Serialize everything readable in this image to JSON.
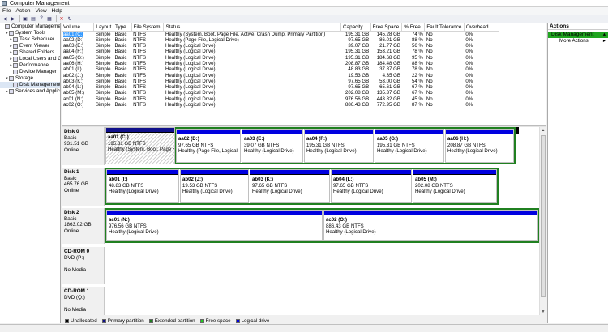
{
  "window": {
    "title": "Computer Management"
  },
  "menu": [
    "File",
    "Action",
    "View",
    "Help"
  ],
  "toolbar": {
    "icons": [
      "back-arrow-icon",
      "forward-arrow-icon",
      "up-folder-icon",
      "properties-icon",
      "help-icon",
      "snap-in-icon",
      "delete-icon",
      "refresh-icon"
    ]
  },
  "tree": [
    {
      "label": "Computer Management",
      "indent": 0,
      "expander": "",
      "selected": false
    },
    {
      "label": "System Tools",
      "indent": 1,
      "expander": "▾",
      "selected": false
    },
    {
      "label": "Task Scheduler",
      "indent": 2,
      "expander": "▸",
      "selected": false
    },
    {
      "label": "Event Viewer",
      "indent": 2,
      "expander": "▸",
      "selected": false
    },
    {
      "label": "Shared Folders",
      "indent": 2,
      "expander": "▸",
      "selected": false
    },
    {
      "label": "Local Users and G",
      "indent": 2,
      "expander": "▸",
      "selected": false
    },
    {
      "label": "Performance",
      "indent": 2,
      "expander": "▸",
      "selected": false
    },
    {
      "label": "Device Manager",
      "indent": 2,
      "expander": "",
      "selected": false
    },
    {
      "label": "Storage",
      "indent": 1,
      "expander": "▾",
      "selected": false
    },
    {
      "label": "Disk Management",
      "indent": 2,
      "expander": "",
      "selected": true
    },
    {
      "label": "Services and Applic",
      "indent": 1,
      "expander": "▸",
      "selected": false
    }
  ],
  "volume_table": {
    "columns": [
      "Volume",
      "Layout",
      "Type",
      "File System",
      "Status",
      "Capacity",
      "Free Space",
      "% Free",
      "Fault Tolerance",
      "Overhead"
    ],
    "rows": [
      [
        "aa01 (C:)",
        "Simple",
        "Basic",
        "NTFS",
        "Healthy (System, Boot, Page File, Active, Crash Dump, Primary Partition)",
        "195.31 GB",
        "145.28 GB",
        "74 %",
        "No",
        "0%"
      ],
      [
        "aa02 (D:)",
        "Simple",
        "Basic",
        "NTFS",
        "Healthy (Page File, Logical Drive)",
        "97.65 GB",
        "86.01 GB",
        "88 %",
        "No",
        "0%"
      ],
      [
        "aa03 (E:)",
        "Simple",
        "Basic",
        "NTFS",
        "Healthy (Logical Drive)",
        "39.07 GB",
        "21.77 GB",
        "56 %",
        "No",
        "0%"
      ],
      [
        "aa04 (F:)",
        "Simple",
        "Basic",
        "NTFS",
        "Healthy (Logical Drive)",
        "195.31 GB",
        "153.21 GB",
        "78 %",
        "No",
        "0%"
      ],
      [
        "aa05 (G:)",
        "Simple",
        "Basic",
        "NTFS",
        "Healthy (Logical Drive)",
        "195.31 GB",
        "184.68 GB",
        "95 %",
        "No",
        "0%"
      ],
      [
        "aa06 (H:)",
        "Simple",
        "Basic",
        "NTFS",
        "Healthy (Logical Drive)",
        "208.87 GB",
        "184.48 GB",
        "88 %",
        "No",
        "0%"
      ],
      [
        "ab01 (I:)",
        "Simple",
        "Basic",
        "NTFS",
        "Healthy (Logical Drive)",
        "48.83 GB",
        "37.87 GB",
        "78 %",
        "No",
        "0%"
      ],
      [
        "ab02 (J:)",
        "Simple",
        "Basic",
        "NTFS",
        "Healthy (Logical Drive)",
        "19.53 GB",
        "4.35 GB",
        "22 %",
        "No",
        "0%"
      ],
      [
        "ab03 (K:)",
        "Simple",
        "Basic",
        "NTFS",
        "Healthy (Logical Drive)",
        "97.65 GB",
        "53.00 GB",
        "54 %",
        "No",
        "0%"
      ],
      [
        "ab04 (L:)",
        "Simple",
        "Basic",
        "NTFS",
        "Healthy (Logical Drive)",
        "97.65 GB",
        "65.61 GB",
        "67 %",
        "No",
        "0%"
      ],
      [
        "ab05 (M:)",
        "Simple",
        "Basic",
        "NTFS",
        "Healthy (Logical Drive)",
        "202.08 GB",
        "135.37 GB",
        "67 %",
        "No",
        "0%"
      ],
      [
        "ac01 (N:)",
        "Simple",
        "Basic",
        "NTFS",
        "Healthy (Logical Drive)",
        "976.56 GB",
        "443.82 GB",
        "45 %",
        "No",
        "0%"
      ],
      [
        "ac02 (O:)",
        "Simple",
        "Basic",
        "NTFS",
        "Healthy (Logical Drive)",
        "886.43 GB",
        "772.95 GB",
        "87 %",
        "No",
        "0%"
      ]
    ]
  },
  "disks": [
    {
      "name": "Disk 0",
      "type": "Basic",
      "size": "931.51 GB",
      "state": "Online",
      "partitions": [
        {
          "name": "aa01 (C:)",
          "size": "195.31 GB NTFS",
          "status": "Healthy (System, Boot, Page F",
          "kind": "primary"
        },
        {
          "name": "aa02 (D:)",
          "size": "97.65 GB NTFS",
          "status": "Healthy (Page File, Logical",
          "kind": "logical"
        },
        {
          "name": "aa03 (E:)",
          "size": "39.07 GB NTFS",
          "status": "Healthy (Logical Drive)",
          "kind": "logical"
        },
        {
          "name": "aa04 (F:)",
          "size": "195.31 GB NTFS",
          "status": "Healthy (Logical Drive)",
          "kind": "logical"
        },
        {
          "name": "aa05 (G:)",
          "size": "195.31 GB NTFS",
          "status": "Healthy (Logical Drive)",
          "kind": "logical"
        },
        {
          "name": "aa06 (H:)",
          "size": "208.87 GB NTFS",
          "status": "Healthy (Logical Drive)",
          "kind": "logical"
        }
      ]
    },
    {
      "name": "Disk 1",
      "type": "Basic",
      "size": "465.76 GB",
      "state": "Online",
      "partitions": [
        {
          "name": "ab01 (I:)",
          "size": "48.83 GB NTFS",
          "status": "Healthy (Logical Drive)",
          "kind": "logical"
        },
        {
          "name": "ab02 (J:)",
          "size": "19.53 GB NTFS",
          "status": "Healthy (Logical Drive)",
          "kind": "logical"
        },
        {
          "name": "ab03 (K:)",
          "size": "97.65 GB NTFS",
          "status": "Healthy (Logical Drive)",
          "kind": "logical"
        },
        {
          "name": "ab04 (L:)",
          "size": "97.65 GB NTFS",
          "status": "Healthy (Logical Drive)",
          "kind": "logical"
        },
        {
          "name": "ab05 (M:)",
          "size": "202.08 GB NTFS",
          "status": "Healthy (Logical Drive)",
          "kind": "logical"
        }
      ]
    },
    {
      "name": "Disk 2",
      "type": "Basic",
      "size": "1863.02 GB",
      "state": "Online",
      "partitions": [
        {
          "name": "ac01 (N:)",
          "size": "976.56 GB NTFS",
          "status": "Healthy (Logical Drive)",
          "kind": "logical"
        },
        {
          "name": "ac02 (O:)",
          "size": "886.43 GB NTFS",
          "status": "Healthy (Logical Drive)",
          "kind": "logical"
        }
      ]
    },
    {
      "name": "CD-ROM 0",
      "type": "DVD (P:)",
      "size": "",
      "state": "No Media",
      "partitions": []
    },
    {
      "name": "CD-ROM 1",
      "type": "DVD (Q:)",
      "size": "",
      "state": "No Media",
      "partitions": []
    }
  ],
  "legend": [
    {
      "label": "Unallocated",
      "color": "#000000"
    },
    {
      "label": "Primary partition",
      "color": "#10108a"
    },
    {
      "label": "Extended partition",
      "color": "#208020"
    },
    {
      "label": "Free space",
      "color": "#20d020"
    },
    {
      "label": "Logical drive",
      "color": "#0000e0"
    }
  ],
  "actions": {
    "header": "Actions",
    "section": "Disk Management",
    "items": [
      "More Actions"
    ]
  },
  "colors": {
    "accent": "#1fa51f",
    "logical": "#0000e0",
    "primary": "#10108a",
    "extended": "#208020"
  }
}
